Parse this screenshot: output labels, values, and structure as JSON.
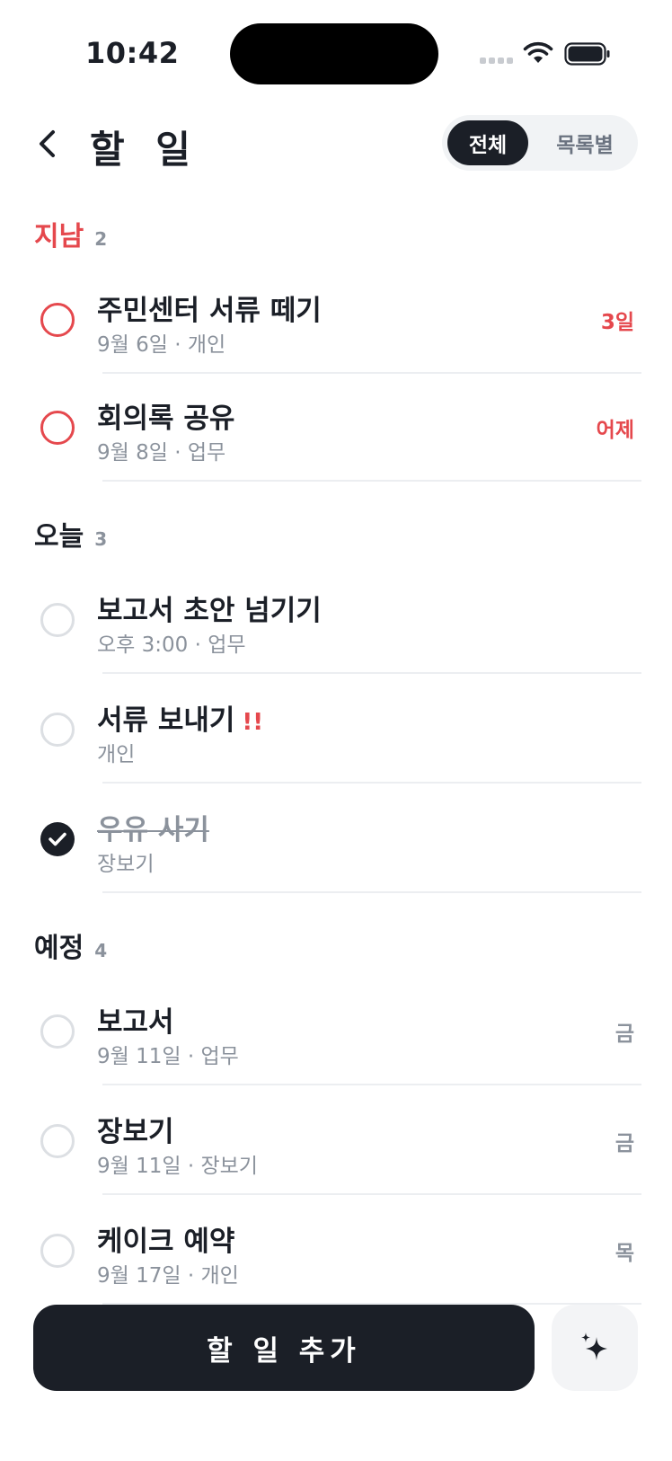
{
  "status": {
    "time": "10:42"
  },
  "header": {
    "title": "할 일",
    "segments": {
      "all": "전체",
      "by_list": "목록별"
    }
  },
  "sections": {
    "overdue": {
      "title": "지남",
      "count": "2",
      "items": [
        {
          "title": "주민센터 서류 떼기",
          "sub": "9월 6일 · 개인",
          "trail": "3일",
          "done": false
        },
        {
          "title": "회의록 공유",
          "sub": "9월 8일 · 업무",
          "trail": "어제",
          "done": false
        }
      ]
    },
    "today": {
      "title": "오늘",
      "count": "3",
      "items": [
        {
          "title": "보고서 초안 넘기기",
          "sub": "오후 3:00 · 업무",
          "done": false
        },
        {
          "title": "서류 보내기",
          "priority": "!!",
          "sub": "개인",
          "done": false
        },
        {
          "title": "우유 사기",
          "sub": "장보기",
          "done": true
        }
      ]
    },
    "upcoming": {
      "title": "예정",
      "count": "4",
      "items": [
        {
          "title": "보고서",
          "sub": "9월 11일 · 업무",
          "trail": "금",
          "done": false
        },
        {
          "title": "장보기",
          "sub": "9월 11일 · 장보기",
          "trail": "금",
          "done": false
        },
        {
          "title": "케이크 예약",
          "sub": "9월 17일 · 개인",
          "trail": "목",
          "done": false
        }
      ]
    }
  },
  "bottom": {
    "add_label": "할 일 추가",
    "ai_icon": "sparkles-icon"
  },
  "colors": {
    "accent_dark": "#1b1f27",
    "overdue_red": "#e5484d",
    "muted": "#8b929c"
  }
}
